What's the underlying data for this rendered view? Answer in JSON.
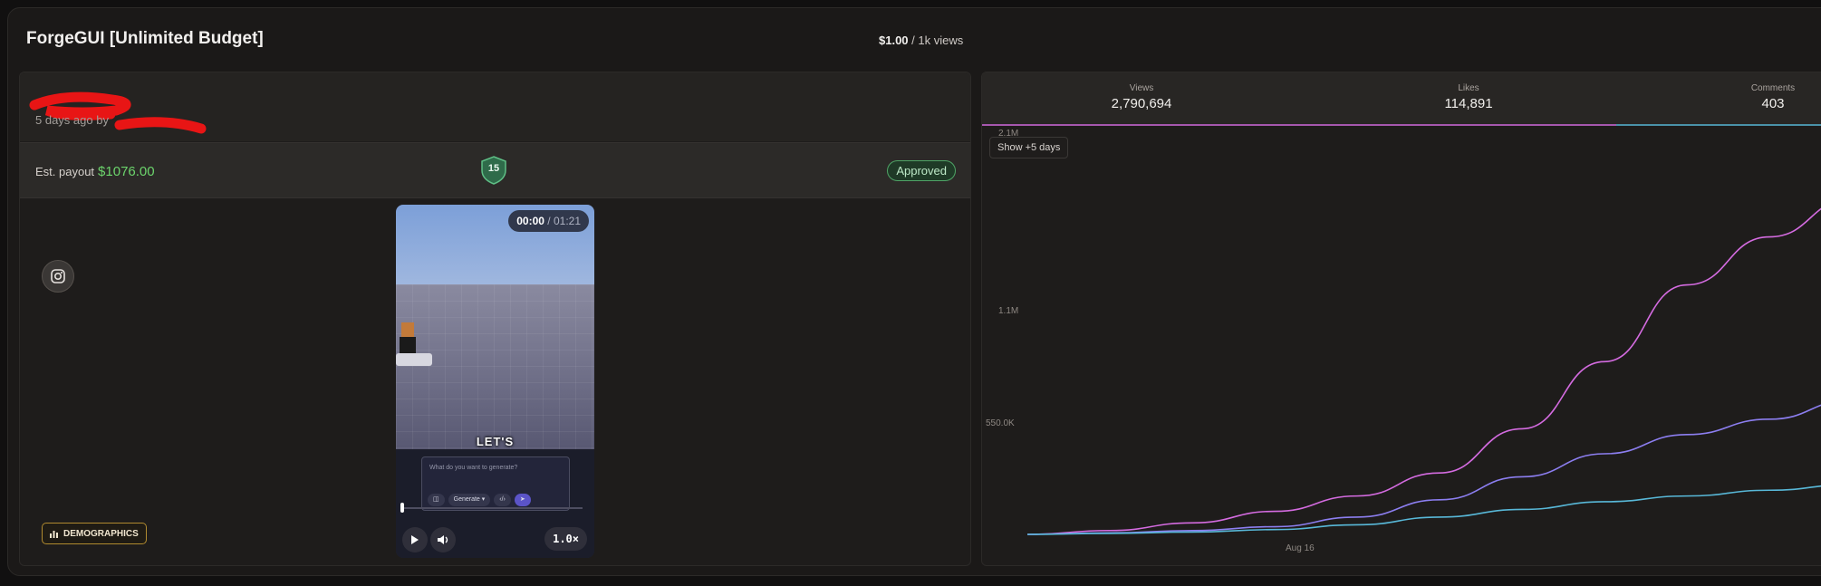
{
  "campaign": {
    "title": "ForgeGUI [Unlimited Budget]",
    "rate_amount": "$1.00",
    "rate_unit": " / 1k views"
  },
  "post": {
    "posted_text": "5 days ago by",
    "payout_label": "Est. payout",
    "payout_value": "$1076.00",
    "score_badge": "15",
    "status": "Approved",
    "platform_icon": "instagram-icon",
    "demographics_label": "DEMOGRAPHICS"
  },
  "video": {
    "time_current": "00:00",
    "time_separator": " / ",
    "time_total": "01:21",
    "caption": "LET'S",
    "prompt_placeholder": "What do you want to generate?",
    "generate_label": "Generate",
    "speed": "1.0×",
    "progress": 0.0
  },
  "stats": {
    "views_label": "Views",
    "views_value": "2,790,694",
    "likes_label": "Likes",
    "likes_value": "114,891",
    "comments_label": "Comments",
    "comments_value": "403"
  },
  "chart_toggle": "Show +5 days",
  "colors": {
    "views_line": "#d46be0",
    "likes_line": "#8c7ef0",
    "comments_line": "#58b8d8",
    "approved": "#4fa466",
    "payout": "#6cd46c"
  },
  "chart_data": {
    "type": "line",
    "y_ticks": [
      "2.1M",
      "1.1M",
      "550.0K"
    ],
    "x_ticks": [
      "Aug 16"
    ],
    "series": [
      {
        "values": [
          0,
          20000,
          60000,
          120000,
          200000,
          320000,
          550000,
          900000,
          1300000,
          1550000,
          1750000
        ]
      },
      {
        "values": [
          0,
          8000,
          20000,
          40000,
          90000,
          180000,
          300000,
          420000,
          520000,
          600000,
          700000
        ]
      },
      {
        "values": [
          0,
          5000,
          12000,
          25000,
          50000,
          90000,
          130000,
          170000,
          200000,
          230000,
          260000
        ]
      }
    ]
  }
}
